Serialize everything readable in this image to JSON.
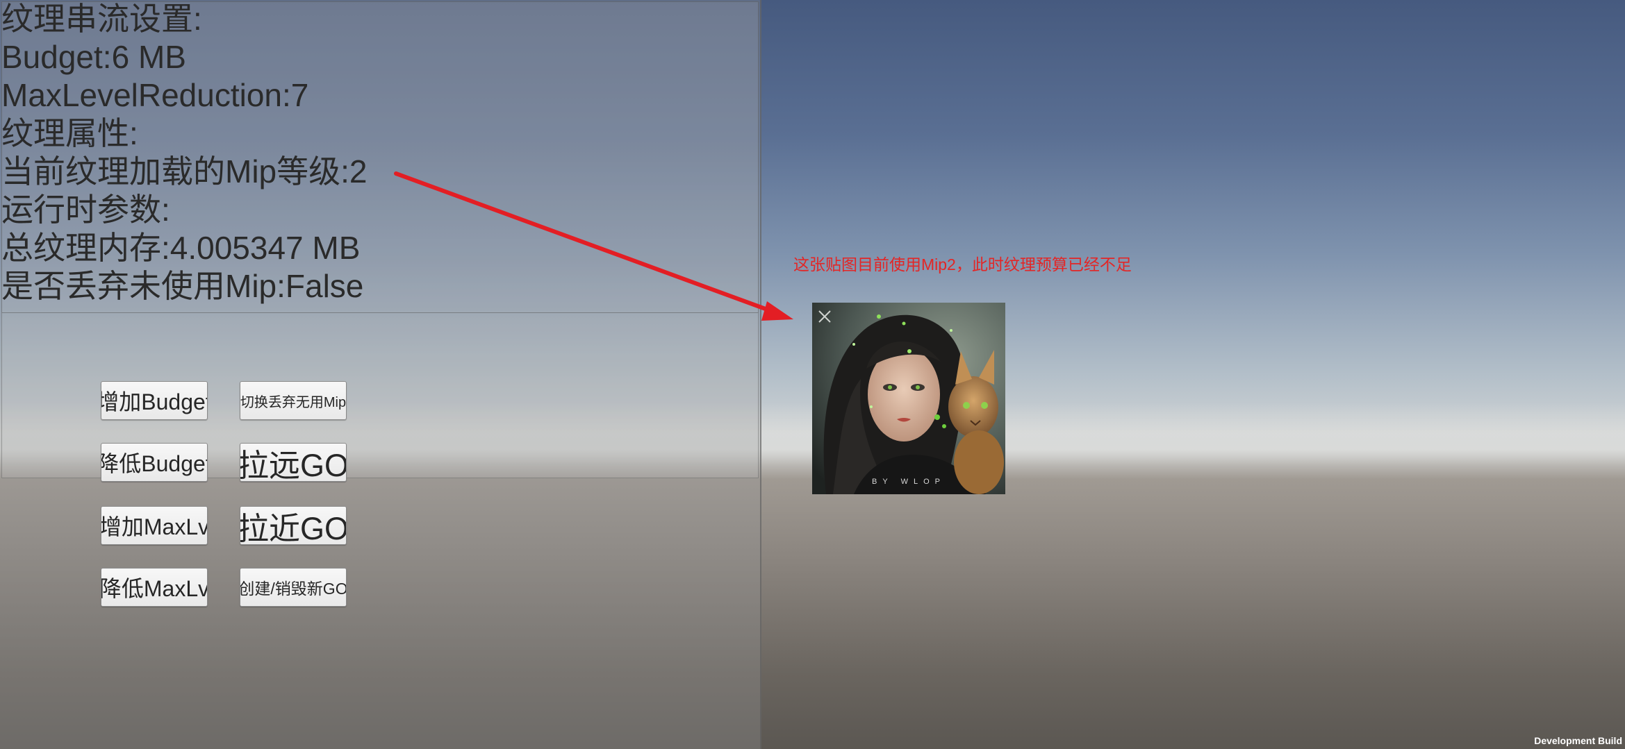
{
  "info_lines": [
    "纹理串流设置:",
    "Budget:6 MB",
    "MaxLevelReduction:7",
    "纹理属性:",
    "当前纹理加载的Mip等级:2",
    "运行时参数:",
    "总纹理内存:4.005347 MB",
    "是否丢弃未使用Mip:False"
  ],
  "buttons": {
    "add_budget": "增加Budget",
    "toggle_discard_mip": "切换丢弃无用Mip",
    "reduce_budget": "降低Budget",
    "move_far_go": "拉远GO",
    "add_maxlv": "增加MaxLv",
    "move_near_go": "拉近GO",
    "reduce_maxlv": "降低MaxLv",
    "create_destroy_go": "创建/销毁新GO"
  },
  "annotation": "这张贴图目前使用Mip2，此时纹理预算已经不足",
  "texture_watermark": "by WLOP",
  "dev_build_label": "Development Build",
  "colors": {
    "annotation": "#e32626",
    "arrow": "#e31e24"
  }
}
